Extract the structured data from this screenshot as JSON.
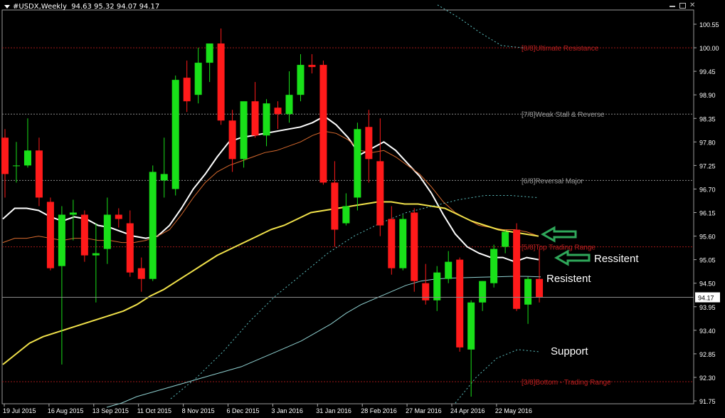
{
  "header": {
    "symbol": "#USDX,Weekly",
    "ohlc": "94.63 95.32 94.07 94.17"
  },
  "chart_data": {
    "type": "candlestick",
    "title": "#USDX,Weekly",
    "y_ticks": [
      "100.55",
      "100.00",
      "99.45",
      "98.90",
      "98.35",
      "97.80",
      "97.25",
      "96.70",
      "96.15",
      "95.60",
      "95.05",
      "94.50",
      "93.95",
      "93.40",
      "92.85",
      "92.30",
      "91.75"
    ],
    "ylim": [
      91.75,
      100.55
    ],
    "current_price": "94.17",
    "x_tick_labels": [
      "19 Jul 2015",
      "16 Aug 2015",
      "13 Sep 2015",
      "11 Oct 2015",
      "8 Nov 2015",
      "6 Dec 2015",
      "3 Jan 2016",
      "31 Jan 2016",
      "28 Feb 2016",
      "27 Mar 2016",
      "24 Apr 2016",
      "22 May 2016"
    ],
    "grid": false,
    "murrey_levels": [
      {
        "label": "[8/8]Ultimate Resistance",
        "price": 100.0
      },
      {
        "label": "[7/8]Weak Stall & Reverse",
        "price": 98.45
      },
      {
        "label": "[6/8]Reversal Major",
        "price": 96.9
      },
      {
        "label": "[5/8]Top Trading Range",
        "price": 95.35
      },
      {
        "label": "[3/8]Bottom - Trading Range",
        "price": 92.2
      }
    ],
    "candles": [
      {
        "o": 97.9,
        "h": 98.1,
        "l": 96.5,
        "c": 97.05
      },
      {
        "o": 97.25,
        "h": 97.8,
        "l": 96.85,
        "c": 97.25
      },
      {
        "o": 97.25,
        "h": 98.35,
        "l": 97.2,
        "c": 97.6
      },
      {
        "o": 97.6,
        "h": 97.9,
        "l": 96.3,
        "c": 96.5
      },
      {
        "o": 96.4,
        "h": 96.5,
        "l": 94.8,
        "c": 94.85
      },
      {
        "o": 94.9,
        "h": 96.3,
        "l": 92.6,
        "c": 96.1
      },
      {
        "o": 96.1,
        "h": 96.45,
        "l": 95.5,
        "c": 96.15
      },
      {
        "o": 96.1,
        "h": 96.2,
        "l": 95.0,
        "c": 95.15
      },
      {
        "o": 95.15,
        "h": 95.9,
        "l": 94.05,
        "c": 95.2
      },
      {
        "o": 95.3,
        "h": 96.5,
        "l": 94.95,
        "c": 96.1
      },
      {
        "o": 96.1,
        "h": 96.25,
        "l": 95.8,
        "c": 96.0
      },
      {
        "o": 95.9,
        "h": 96.2,
        "l": 94.65,
        "c": 94.75
      },
      {
        "o": 94.85,
        "h": 95.1,
        "l": 94.3,
        "c": 94.6
      },
      {
        "o": 94.6,
        "h": 97.25,
        "l": 94.55,
        "c": 97.1
      },
      {
        "o": 96.9,
        "h": 97.9,
        "l": 96.5,
        "c": 97.05
      },
      {
        "o": 96.7,
        "h": 99.35,
        "l": 96.55,
        "c": 99.25
      },
      {
        "o": 99.3,
        "h": 99.7,
        "l": 98.5,
        "c": 98.75
      },
      {
        "o": 98.9,
        "h": 100.0,
        "l": 98.7,
        "c": 99.65
      },
      {
        "o": 99.65,
        "h": 100.1,
        "l": 99.2,
        "c": 100.1
      },
      {
        "o": 100.1,
        "h": 100.45,
        "l": 98.2,
        "c": 98.3
      },
      {
        "o": 98.3,
        "h": 98.55,
        "l": 97.1,
        "c": 97.4
      },
      {
        "o": 97.4,
        "h": 98.6,
        "l": 97.2,
        "c": 98.75
      },
      {
        "o": 98.75,
        "h": 99.2,
        "l": 97.9,
        "c": 97.95
      },
      {
        "o": 97.95,
        "h": 98.8,
        "l": 97.7,
        "c": 98.7
      },
      {
        "o": 98.6,
        "h": 98.75,
        "l": 98.1,
        "c": 98.45
      },
      {
        "o": 98.45,
        "h": 99.45,
        "l": 98.25,
        "c": 98.9
      },
      {
        "o": 98.9,
        "h": 99.85,
        "l": 98.75,
        "c": 99.6
      },
      {
        "o": 99.6,
        "h": 99.85,
        "l": 99.4,
        "c": 99.55
      },
      {
        "o": 99.6,
        "h": 99.7,
        "l": 96.8,
        "c": 96.85
      },
      {
        "o": 96.85,
        "h": 97.35,
        "l": 95.35,
        "c": 95.75
      },
      {
        "o": 95.9,
        "h": 96.6,
        "l": 95.85,
        "c": 96.3
      },
      {
        "o": 96.5,
        "h": 98.25,
        "l": 96.2,
        "c": 98.1
      },
      {
        "o": 98.15,
        "h": 98.55,
        "l": 96.85,
        "c": 97.4
      },
      {
        "o": 97.35,
        "h": 98.35,
        "l": 95.6,
        "c": 95.85
      },
      {
        "o": 96.0,
        "h": 96.3,
        "l": 94.7,
        "c": 94.85
      },
      {
        "o": 94.85,
        "h": 96.1,
        "l": 94.8,
        "c": 96.0
      },
      {
        "o": 96.15,
        "h": 96.25,
        "l": 94.3,
        "c": 94.55
      },
      {
        "o": 94.5,
        "h": 94.95,
        "l": 94.0,
        "c": 94.1
      },
      {
        "o": 94.1,
        "h": 94.9,
        "l": 93.85,
        "c": 94.75
      },
      {
        "o": 94.6,
        "h": 95.25,
        "l": 94.5,
        "c": 95.0
      },
      {
        "o": 95.05,
        "h": 95.1,
        "l": 92.9,
        "c": 93.0
      },
      {
        "o": 92.95,
        "h": 94.1,
        "l": 91.85,
        "c": 94.05
      },
      {
        "o": 94.05,
        "h": 94.55,
        "l": 93.85,
        "c": 94.55
      },
      {
        "o": 94.5,
        "h": 95.4,
        "l": 94.4,
        "c": 95.3
      },
      {
        "o": 95.35,
        "h": 95.75,
        "l": 95.2,
        "c": 95.7
      },
      {
        "o": 95.75,
        "h": 95.9,
        "l": 93.85,
        "c": 93.9
      },
      {
        "o": 94.0,
        "h": 94.65,
        "l": 93.55,
        "c": 94.6
      },
      {
        "o": 94.6,
        "h": 95.3,
        "l": 94.05,
        "c": 94.17
      }
    ],
    "series": [
      {
        "type": "line",
        "color": "#ffffff",
        "y": [
          96.0,
          96.25,
          96.25,
          96.2,
          96.05,
          95.95,
          96.05,
          96.0,
          95.85,
          95.8,
          95.7,
          95.6,
          95.55,
          95.6,
          95.85,
          96.25,
          96.7,
          97.05,
          97.45,
          97.8,
          97.9,
          97.95,
          98.0,
          98.05,
          98.1,
          98.15,
          98.25,
          98.4,
          98.2,
          97.9,
          97.5,
          97.65,
          97.8,
          97.6,
          97.3,
          97.0,
          96.6,
          96.1,
          95.65,
          95.35,
          95.2,
          95.1,
          95.1,
          95.0,
          95.1,
          95.05
        ]
      },
      {
        "type": "line",
        "color": "#d86a2e",
        "y": [
          95.45,
          95.55,
          95.55,
          95.6,
          95.55,
          95.5,
          95.55,
          95.55,
          95.5,
          95.5,
          95.45,
          95.45,
          95.5,
          95.6,
          95.75,
          96.1,
          96.5,
          96.85,
          97.1,
          97.25,
          97.35,
          97.45,
          97.55,
          97.6,
          97.7,
          97.8,
          97.95,
          98.05,
          98.0,
          97.85,
          97.6,
          97.55,
          97.6,
          97.45,
          97.25,
          97.05,
          96.75,
          96.4,
          96.15,
          96.0,
          95.85,
          95.8,
          95.75,
          95.75,
          95.7,
          95.6
        ]
      },
      {
        "type": "line",
        "color": "#f0e14a",
        "y": [
          92.6,
          92.85,
          93.1,
          93.25,
          93.35,
          93.45,
          93.55,
          93.65,
          93.75,
          93.85,
          94.0,
          94.2,
          94.35,
          94.55,
          94.75,
          94.95,
          95.15,
          95.3,
          95.45,
          95.6,
          95.75,
          95.85,
          96.0,
          96.15,
          96.2,
          96.25,
          96.3,
          96.35,
          96.4,
          96.4,
          96.35,
          96.35,
          96.3,
          96.25,
          96.1,
          95.95,
          95.85,
          95.75,
          95.7,
          95.65,
          95.6
        ]
      },
      {
        "type": "line",
        "color": "#8fd0d0",
        "y": [
          91.6,
          91.7,
          91.85,
          91.95,
          92.05,
          92.15,
          92.25,
          92.35,
          92.45,
          92.55,
          92.7,
          92.85,
          93.0,
          93.15,
          93.35,
          93.55,
          93.8,
          94.0,
          94.15,
          94.3,
          94.45,
          94.55,
          94.6,
          94.62,
          94.63,
          94.64,
          94.65,
          94.66,
          94.66,
          94.65
        ]
      },
      {
        "type": "dotted",
        "color": "#5cc0c0",
        "y": [
          91.8,
          92.3,
          92.9,
          93.6,
          94.2,
          94.7,
          95.2,
          95.6,
          95.9,
          96.15,
          96.3,
          96.45,
          96.55,
          96.55,
          96.5
        ]
      },
      {
        "type": "dotted",
        "color": "#5cc0c0",
        "y": [
          101.0,
          100.7,
          100.35,
          100.05,
          100.0
        ]
      },
      {
        "type": "dotted",
        "color": "#5cc0c0",
        "y": [
          91.7,
          92.3,
          92.75,
          92.95,
          92.9
        ]
      }
    ],
    "annotations": [
      {
        "text": "Ressitent"
      },
      {
        "text": "Resistent"
      },
      {
        "text": "Support"
      }
    ]
  }
}
